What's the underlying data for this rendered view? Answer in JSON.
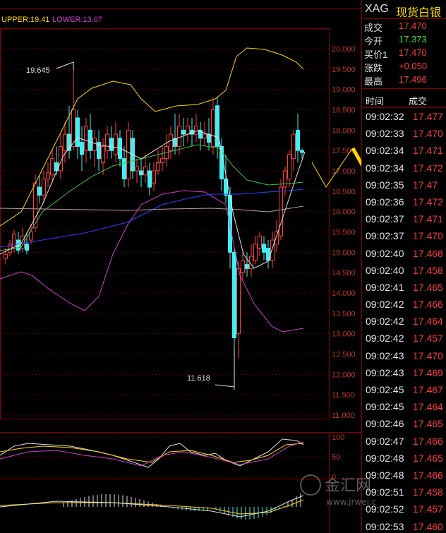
{
  "indicator": {
    "upper_label": "UPPER:19.41",
    "lower_label": "LOWER:13.07",
    "upper_color": "#ffd800",
    "lower_color": "#d040d0"
  },
  "price_axis": [
    "20.000",
    "19.500",
    "19.000",
    "18.500",
    "18.000",
    "17.500",
    "17.000",
    "16.500",
    "16.000",
    "15.500",
    "15.000",
    "14.500",
    "14.000",
    "13.500",
    "13.000",
    "12.500",
    "12.000",
    "11.500",
    "11.000"
  ],
  "oscillator_axis": [
    "100",
    "50",
    "0"
  ],
  "annotations": {
    "high": "19.645",
    "low": "11.618"
  },
  "header": {
    "symbol": "XAG",
    "name": "现货白银"
  },
  "quote": [
    {
      "label": "成交",
      "value": "17.470",
      "color": "#ff3b3b"
    },
    {
      "label": "今开",
      "value": "17.373",
      "color": "#30e030"
    },
    {
      "label": "买价1",
      "value": "17.470",
      "color": "#ff3b3b"
    },
    {
      "label": "涨跌",
      "value": "+0.050",
      "color": "#ff3b3b"
    },
    {
      "label": "最高",
      "value": "17.496",
      "color": "#ff3b3b"
    }
  ],
  "ticks_header": {
    "time": "时间",
    "price": "成交"
  },
  "ticks": [
    {
      "time": "09:02:32",
      "price": "17.477"
    },
    {
      "time": "09:02:33",
      "price": "17.470"
    },
    {
      "time": "09:02:34",
      "price": "17.471"
    },
    {
      "time": "09:02:34",
      "price": "17.472"
    },
    {
      "time": "09:02:35",
      "price": "17.47"
    },
    {
      "time": "09:02:36",
      "price": "17.472"
    },
    {
      "time": "09:02:37",
      "price": "17.471"
    },
    {
      "time": "09:02:37",
      "price": "17.470"
    },
    {
      "time": "09:02:40",
      "price": "17.468"
    },
    {
      "time": "09:02:40",
      "price": "17.458"
    },
    {
      "time": "09:02:41",
      "price": "17.465"
    },
    {
      "time": "09:02:42",
      "price": "17.466"
    },
    {
      "time": "09:02:42",
      "price": "17.464"
    },
    {
      "time": "09:02:42",
      "price": "17.457"
    },
    {
      "time": "09:02:43",
      "price": "17.470"
    },
    {
      "time": "09:02:43",
      "price": "17.469"
    },
    {
      "time": "09:02:45",
      "price": "17.467"
    },
    {
      "time": "09:02:45",
      "price": "17.464"
    },
    {
      "time": "09:02:46",
      "price": "17.465"
    },
    {
      "time": "09:02:47",
      "price": "17.466"
    },
    {
      "time": "09:02:48",
      "price": "17.465"
    },
    {
      "time": "09:02:48",
      "price": "17.466"
    },
    {
      "time": "09:02:51",
      "price": "17.458"
    },
    {
      "time": "09:02:52",
      "price": "17.457"
    },
    {
      "time": "09:02:53",
      "price": "17.460"
    }
  ],
  "tick_price_color": "#ff3b3b",
  "watermark": {
    "brand": "金汇网",
    "url": "www.jrwei.com"
  }
}
